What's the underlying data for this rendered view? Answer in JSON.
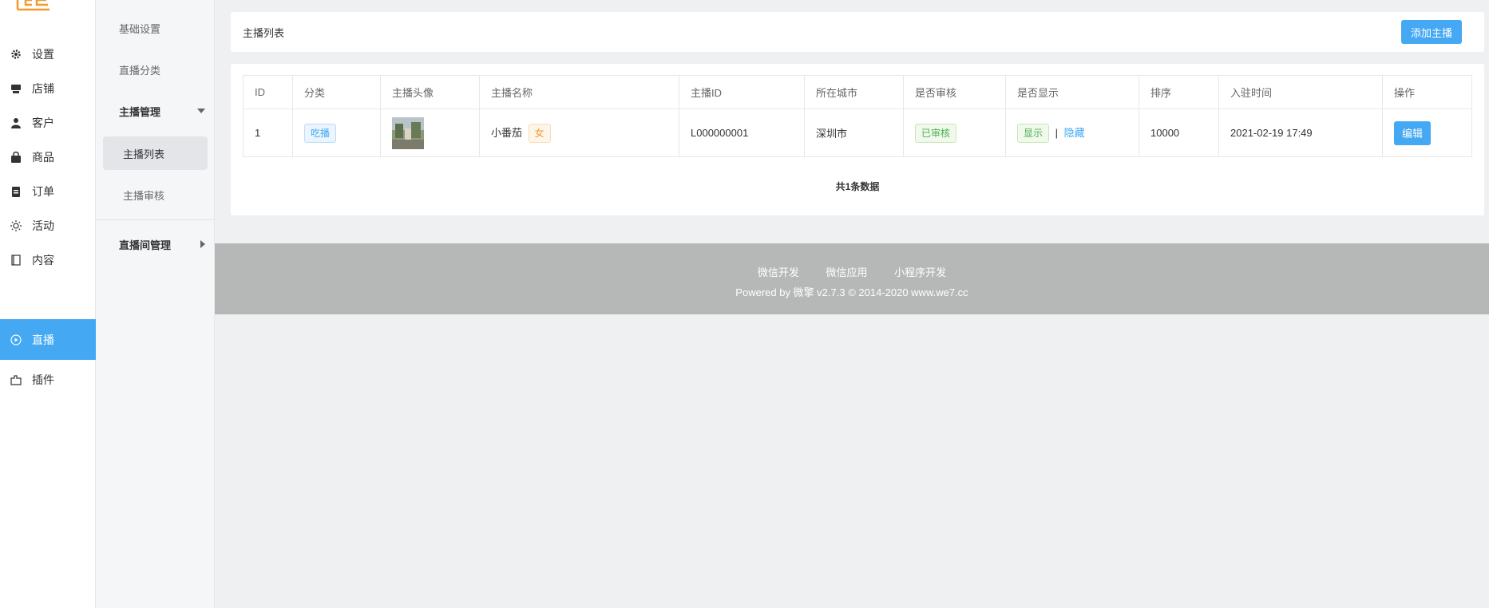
{
  "nav": {
    "items": [
      {
        "label": "设置",
        "icon": "gear-icon"
      },
      {
        "label": "店铺",
        "icon": "store-icon"
      },
      {
        "label": "客户",
        "icon": "user-icon"
      },
      {
        "label": "商品",
        "icon": "bag-icon"
      },
      {
        "label": "订单",
        "icon": "clipboard-icon"
      },
      {
        "label": "活动",
        "icon": "sun-icon"
      },
      {
        "label": "内容",
        "icon": "book-icon"
      },
      {
        "label": "直播",
        "icon": "play-circle-icon",
        "active": true
      },
      {
        "label": "插件",
        "icon": "plugin-icon"
      }
    ]
  },
  "submenu": {
    "basic": "基础设置",
    "category": "直播分类",
    "anchor_mgmt": "主播管理",
    "anchor_list": "主播列表",
    "anchor_review": "主播审核",
    "room_mgmt": "直播间管理"
  },
  "header": {
    "title": "主播列表",
    "add_button": "添加主播"
  },
  "table": {
    "columns": [
      "ID",
      "分类",
      "主播头像",
      "主播名称",
      "主播ID",
      "所在城市",
      "是否审核",
      "是否显示",
      "排序",
      "入驻时间",
      "操作"
    ],
    "rows": [
      {
        "id": "1",
        "category": "吃播",
        "name": "小番茄",
        "gender": "女",
        "anchor_id": "L000000001",
        "city": "深圳市",
        "review": "已审核",
        "display": "显示",
        "sep": "|",
        "hide": "隐藏",
        "sort": "10000",
        "joined": "2021-02-19 17:49",
        "action": "编辑"
      }
    ],
    "total": "共1条数据"
  },
  "footer": {
    "link1": "微信开发",
    "link2": "微信应用",
    "link3": "小程序开发",
    "power": "Powered by 微擎 v2.7.3 © 2014-2020 www.we7.cc"
  },
  "colors": {
    "accent": "#44a8f2",
    "logo": "#f39a2e",
    "footer": "#b6b7b7"
  }
}
